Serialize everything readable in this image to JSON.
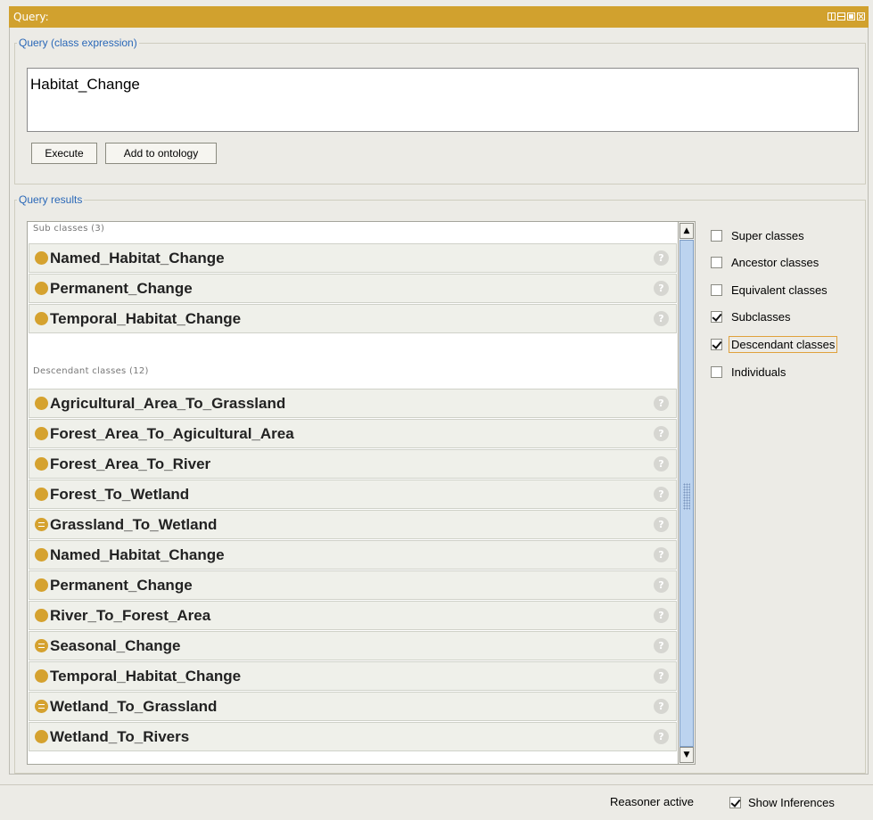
{
  "title": "Query:",
  "query_group": {
    "legend": "Query (class expression)",
    "expression": "Habitat_Change",
    "execute_label": "Execute",
    "add_label": "Add to ontology"
  },
  "results_group": {
    "legend": "Query results",
    "sub_header": "Sub classes (3)",
    "sub_items": [
      {
        "label": "Named_Habitat_Change",
        "equivalent": false
      },
      {
        "label": "Permanent_Change",
        "equivalent": false
      },
      {
        "label": "Temporal_Habitat_Change",
        "equivalent": false
      }
    ],
    "desc_header": "Descendant classes (12)",
    "desc_items": [
      {
        "label": "Agricultural_Area_To_Grassland",
        "equivalent": false
      },
      {
        "label": "Forest_Area_To_Agicultural_Area",
        "equivalent": false
      },
      {
        "label": "Forest_Area_To_River",
        "equivalent": false
      },
      {
        "label": "Forest_To_Wetland",
        "equivalent": false
      },
      {
        "label": "Grassland_To_Wetland",
        "equivalent": true
      },
      {
        "label": "Named_Habitat_Change",
        "equivalent": false
      },
      {
        "label": "Permanent_Change",
        "equivalent": false
      },
      {
        "label": "River_To_Forest_Area",
        "equivalent": false
      },
      {
        "label": "Seasonal_Change",
        "equivalent": true
      },
      {
        "label": "Temporal_Habitat_Change",
        "equivalent": false
      },
      {
        "label": "Wetland_To_Grassland",
        "equivalent": true
      },
      {
        "label": "Wetland_To_Rivers",
        "equivalent": false
      }
    ],
    "help_glyph": "?",
    "options": [
      {
        "label": "Super classes",
        "checked": false
      },
      {
        "label": "Ancestor classes",
        "checked": false
      },
      {
        "label": "Equivalent classes",
        "checked": false
      },
      {
        "label": "Subclasses",
        "checked": true
      },
      {
        "label": "Descendant classes",
        "checked": true,
        "focused": true
      },
      {
        "label": "Individuals",
        "checked": false
      }
    ]
  },
  "status": {
    "reasoner": "Reasoner active",
    "show_inferences": "Show Inferences",
    "show_inferences_checked": true
  },
  "colors": {
    "title_bar": "#d1a12e",
    "class_dot": "#d5a22f",
    "legend_text": "#2a68b8",
    "scroll_thumb": "#bcd3ef"
  },
  "icons": {
    "window_controls": [
      "tile-icon",
      "split-icon",
      "maximize-icon",
      "close-icon"
    ],
    "class": "class-icon",
    "equivalent_class": "equivalent-class-icon",
    "help": "help-icon"
  }
}
